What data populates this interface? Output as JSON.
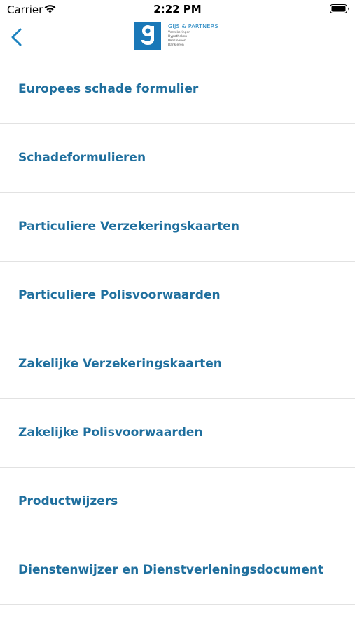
{
  "status_bar": {
    "carrier": "Carrier",
    "time": "2:22 PM"
  },
  "nav": {
    "back_icon": "chevron-left-icon",
    "logo": {
      "name": "GIJS & PARTNERS",
      "tagline": [
        "Verzekeringen",
        "Hypotheken",
        "Pensioenen",
        "Bankieren"
      ]
    }
  },
  "menu": {
    "items": [
      {
        "label": "Europees schade formulier"
      },
      {
        "label": "Schadeformulieren"
      },
      {
        "label": "Particuliere Verzekeringskaarten"
      },
      {
        "label": "Particuliere Polisvoorwaarden"
      },
      {
        "label": "Zakelijke Verzekeringskaarten"
      },
      {
        "label": "Zakelijke Polisvoorwaarden"
      },
      {
        "label": "Productwijzers"
      },
      {
        "label": "Dienstenwijzer en Dienstverleningsdocument"
      }
    ]
  },
  "colors": {
    "accent": "#1d83c0",
    "item_text": "#1f6f9e",
    "logo_blue": "#1a78b8"
  }
}
